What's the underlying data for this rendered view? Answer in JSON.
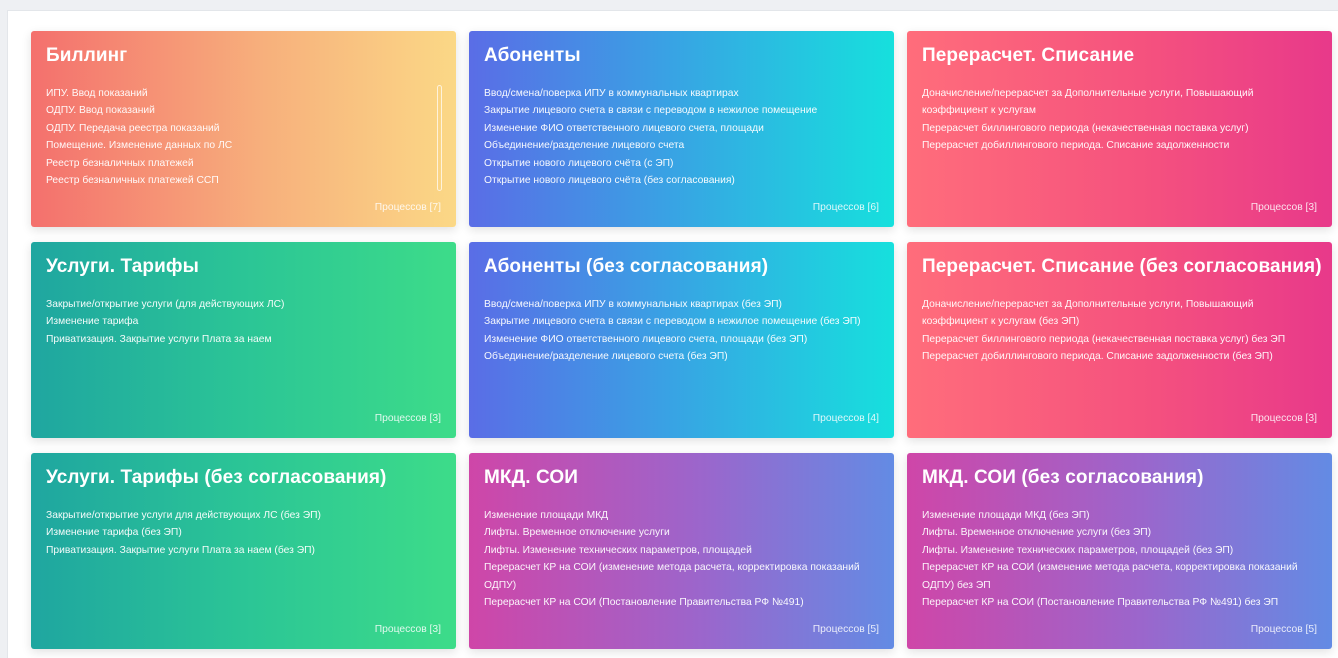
{
  "cards": [
    {
      "title": "Биллинг",
      "items": [
        "ИПУ. Ввод показаний",
        "ОДПУ. Ввод показаний",
        "ОДПУ. Передача реестра показаний",
        "Помещение. Изменение данных по ЛС",
        "Реестр безналичных платежей",
        "Реестр безналичных платежей ССП"
      ],
      "count_label": "Процессов [7]"
    },
    {
      "title": "Абоненты",
      "items": [
        "Ввод/смена/поверка ИПУ в коммунальных квартирах",
        "Закрытие лицевого счета в связи с переводом в нежилое помещение",
        "Изменение ФИО ответственного лицевого счета, площади",
        "Объединение/разделение лицевого счета",
        "Открытие нового лицевого счёта (с ЭП)",
        "Открытие нового лицевого счёта (без согласования)"
      ],
      "count_label": "Процессов [6]"
    },
    {
      "title": "Перерасчет. Списание",
      "items": [
        "Доначисление/перерасчет за Дополнительные услуги, Повышающий коэффициент к услугам",
        "Перерасчет биллингового периода (некачественная поставка услуг)",
        "Перерасчет добиллингового периода. Списание задолженности"
      ],
      "count_label": "Процессов [3]"
    },
    {
      "title": "Услуги. Тарифы",
      "items": [
        "Закрытие/открытие услуги (для действующих ЛС)",
        "Изменение тарифа",
        "Приватизация. Закрытие услуги Плата за наем"
      ],
      "count_label": "Процессов [3]"
    },
    {
      "title": "Абоненты (без согласования)",
      "items": [
        "Ввод/смена/поверка ИПУ в коммунальных квартирах (без ЭП)",
        "Закрытие лицевого счета в связи с переводом в нежилое помещение (без ЭП)",
        "Изменение ФИО ответственного лицевого счета, площади (без ЭП)",
        "Объединение/разделение лицевого счета (без ЭП)"
      ],
      "count_label": "Процессов [4]"
    },
    {
      "title": "Перерасчет. Списание (без согласования)",
      "items": [
        "Доначисление/перерасчет за Дополнительные услуги, Повышающий коэффициент к услугам (без ЭП)",
        "Перерасчет биллингового периода (некачественная поставка услуг) без ЭП",
        "Перерасчет добиллингового периода. Списание задолженности (без ЭП)"
      ],
      "count_label": "Процессов [3]"
    },
    {
      "title": "Услуги. Тарифы (без согласования)",
      "items": [
        "Закрытие/открытие услуги для действующих ЛС (без ЭП)",
        "Изменение тарифа (без ЭП)",
        "Приватизация. Закрытие услуги Плата за наем (без ЭП)"
      ],
      "count_label": "Процессов [3]"
    },
    {
      "title": "МКД. СОИ",
      "items": [
        "Изменение площади МКД",
        "Лифты. Временное отключение услуги",
        "Лифты. Изменение технических параметров, площадей",
        "Перерасчет КР на СОИ (изменение метода расчета, корректировка показаний ОДПУ)",
        "Перерасчет КР на СОИ (Постановление Правительства РФ №491)"
      ],
      "count_label": "Процессов [5]"
    },
    {
      "title": "МКД. СОИ (без согласования)",
      "items": [
        "Изменение площади МКД (без ЭП)",
        "Лифты. Временное отключение услуги (без ЭП)",
        "Лифты. Изменение технических параметров, площадей (без ЭП)",
        "Перерасчет КР на СОИ (изменение метода расчета, корректировка показаний ОДПУ) без ЭП",
        "Перерасчет КР на СОИ (Постановление Правительства РФ №491) без ЭП"
      ],
      "count_label": "Процессов [5]"
    }
  ]
}
